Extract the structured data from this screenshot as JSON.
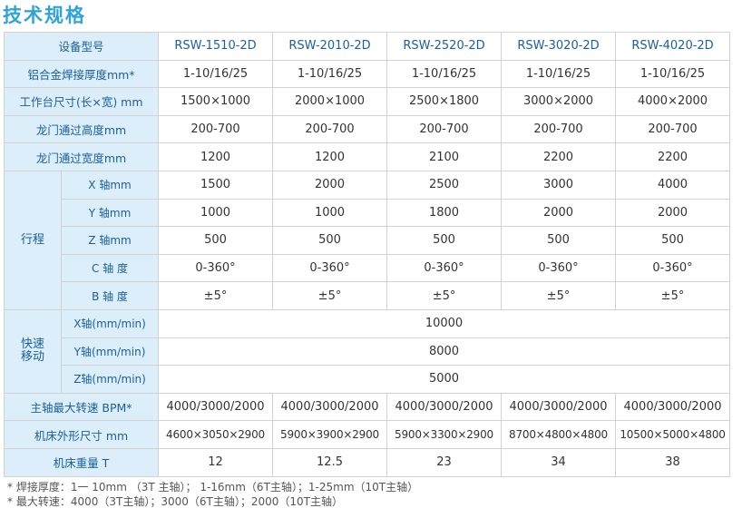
{
  "title": "技术规格",
  "header": {
    "label": "设备型号",
    "models": [
      "RSW-1510-2D",
      "RSW-2010-2D",
      "RSW-2520-2D",
      "RSW-3020-2D",
      "RSW-4020-2D"
    ]
  },
  "rows_top": [
    {
      "label": "铝合金焊接厚度mm*",
      "values": [
        "1-10/16/25",
        "1-10/16/25",
        "1-10/16/25",
        "1-10/16/25",
        "1-10/16/25"
      ]
    },
    {
      "label": "工作台尺寸(长×宽) mm",
      "values": [
        "1500×1000",
        "2000×1000",
        "2500×1800",
        "3000×2000",
        "4000×2000"
      ]
    },
    {
      "label": "龙门通过高度mm",
      "values": [
        "200-700",
        "200-700",
        "200-700",
        "200-700",
        "200-700"
      ]
    },
    {
      "label": "龙门通过宽度mm",
      "values": [
        "1200",
        "1200",
        "2100",
        "2200",
        "2200"
      ]
    }
  ],
  "travel": {
    "group_label": "行程",
    "rows": [
      {
        "label": "X 轴mm",
        "values": [
          "1500",
          "2000",
          "2500",
          "3000",
          "4000"
        ]
      },
      {
        "label": "Y 轴mm",
        "values": [
          "1000",
          "1000",
          "1800",
          "2000",
          "2000"
        ]
      },
      {
        "label": "Z 轴mm",
        "values": [
          "500",
          "500",
          "500",
          "500",
          "500"
        ]
      },
      {
        "label": "C 轴 度",
        "values": [
          "0-360°",
          "0-360°",
          "0-360°",
          "0-360°",
          "0-360°"
        ]
      },
      {
        "label": "B 轴 度",
        "values": [
          "±5°",
          "±5°",
          "±5°",
          "±5°",
          "±5°"
        ]
      }
    ]
  },
  "rapid": {
    "group_label_line1": "快速",
    "group_label_line2": "移动",
    "rows": [
      {
        "label": "X轴(mm/min)",
        "value": "10000"
      },
      {
        "label": "Y轴(mm/min)",
        "value": "8000"
      },
      {
        "label": "Z轴(mm/min)",
        "value": "5000"
      }
    ]
  },
  "rows_bottom": [
    {
      "label": "主轴最大转速 BPM*",
      "values": [
        "4000/3000/2000",
        "4000/3000/2000",
        "4000/3000/2000",
        "4000/3000/2000",
        "4000/3000/2000"
      ]
    },
    {
      "label": "机床外形尺寸 mm",
      "values": [
        "4600×3050×2900",
        "5900×3900×2900",
        "5900×3300×2900",
        "8700×4800×4800",
        "10500×5000×4800"
      ]
    },
    {
      "label": "机床重量 T",
      "values": [
        "12",
        "12.5",
        "23",
        "34",
        "38"
      ]
    }
  ],
  "notes": {
    "line1": "* 焊接厚度：1一 10mm （3T 主轴）； 1-16mm（6T主轴）；1-25mm（10T主轴）",
    "line2": "* 最大转速：4000（3T主轴）；3000（6T主轴）；2000（10T主轴）"
  }
}
